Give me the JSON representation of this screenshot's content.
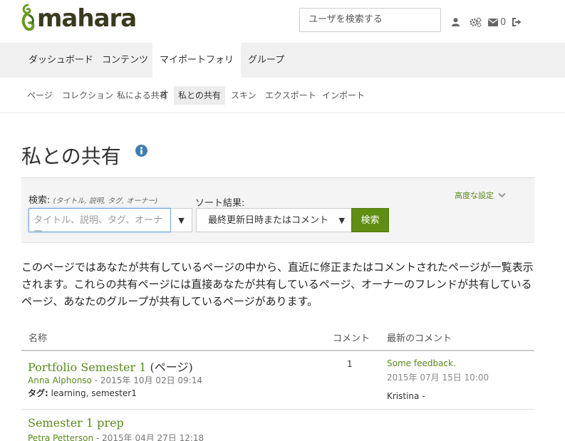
{
  "header": {
    "logo_text": "mahara",
    "search_placeholder": "ユーザを検索する",
    "message_count": "0",
    "icons": [
      "user-icon",
      "gears-icon",
      "envelope-icon",
      "logout-icon"
    ]
  },
  "main_nav": [
    {
      "label": "ダッシュボード",
      "active": false
    },
    {
      "label": "コンテンツ",
      "active": false
    },
    {
      "label": "マイポートフォリオ",
      "active": true
    },
    {
      "label": "グループ",
      "active": false
    }
  ],
  "sub_nav": [
    {
      "label": "ページ",
      "active": false
    },
    {
      "label": "コレクション",
      "active": false
    },
    {
      "label": "私による共有",
      "active": false
    },
    {
      "label": "私との共有",
      "active": true
    },
    {
      "label": "スキン",
      "active": false
    },
    {
      "label": "エクスポート",
      "active": false
    },
    {
      "label": "インポート",
      "active": false
    }
  ],
  "page_title": "私との共有",
  "search_panel": {
    "search_label": "検索:",
    "search_hint": "(タイトル, 説明, タグ, オーナー)",
    "search_placeholder": "タイトル、説明、タグ、オーナー",
    "search_dropdown": "▼",
    "sort_label": "ソート結果:",
    "sort_value": "最終更新日時またはコメント",
    "sort_caret": "▼",
    "search_button": "検索",
    "advanced_label": "高度な設定"
  },
  "description": "このページではあなたが共有しているページの中から、直近に修正またはコメントされたページが一覧表示されます。これらの共有ページには直接あなたが共有しているページ、オーナーのフレンドが共有しているページ、あなたのグループが共有しているページがあります。",
  "table": {
    "headers": {
      "name": "名称",
      "comments": "コメント",
      "latest": "最新のコメント"
    },
    "rows": [
      {
        "title": "Portfolio Semester 1",
        "suffix": " (ページ)",
        "owner": "Anna Alphonso",
        "date": " - 2015年 10月 02日 09:14",
        "tags_label": "タグ:",
        "tags": " learning, semester1",
        "comment_count": "1",
        "latest_comment": "Some feedback.",
        "latest_date": "2015年 07月 15日 10:00",
        "latest_author": "Kristina -"
      },
      {
        "title": "Semester 1 prep",
        "owner": "Petra Petterson",
        "date": " - 2015年 04月 27日 12:18"
      }
    ]
  },
  "colors": {
    "accent_green": "#5a8a1a",
    "button_green": "#5f8f12",
    "nav_bg": "#f0f0f0"
  }
}
